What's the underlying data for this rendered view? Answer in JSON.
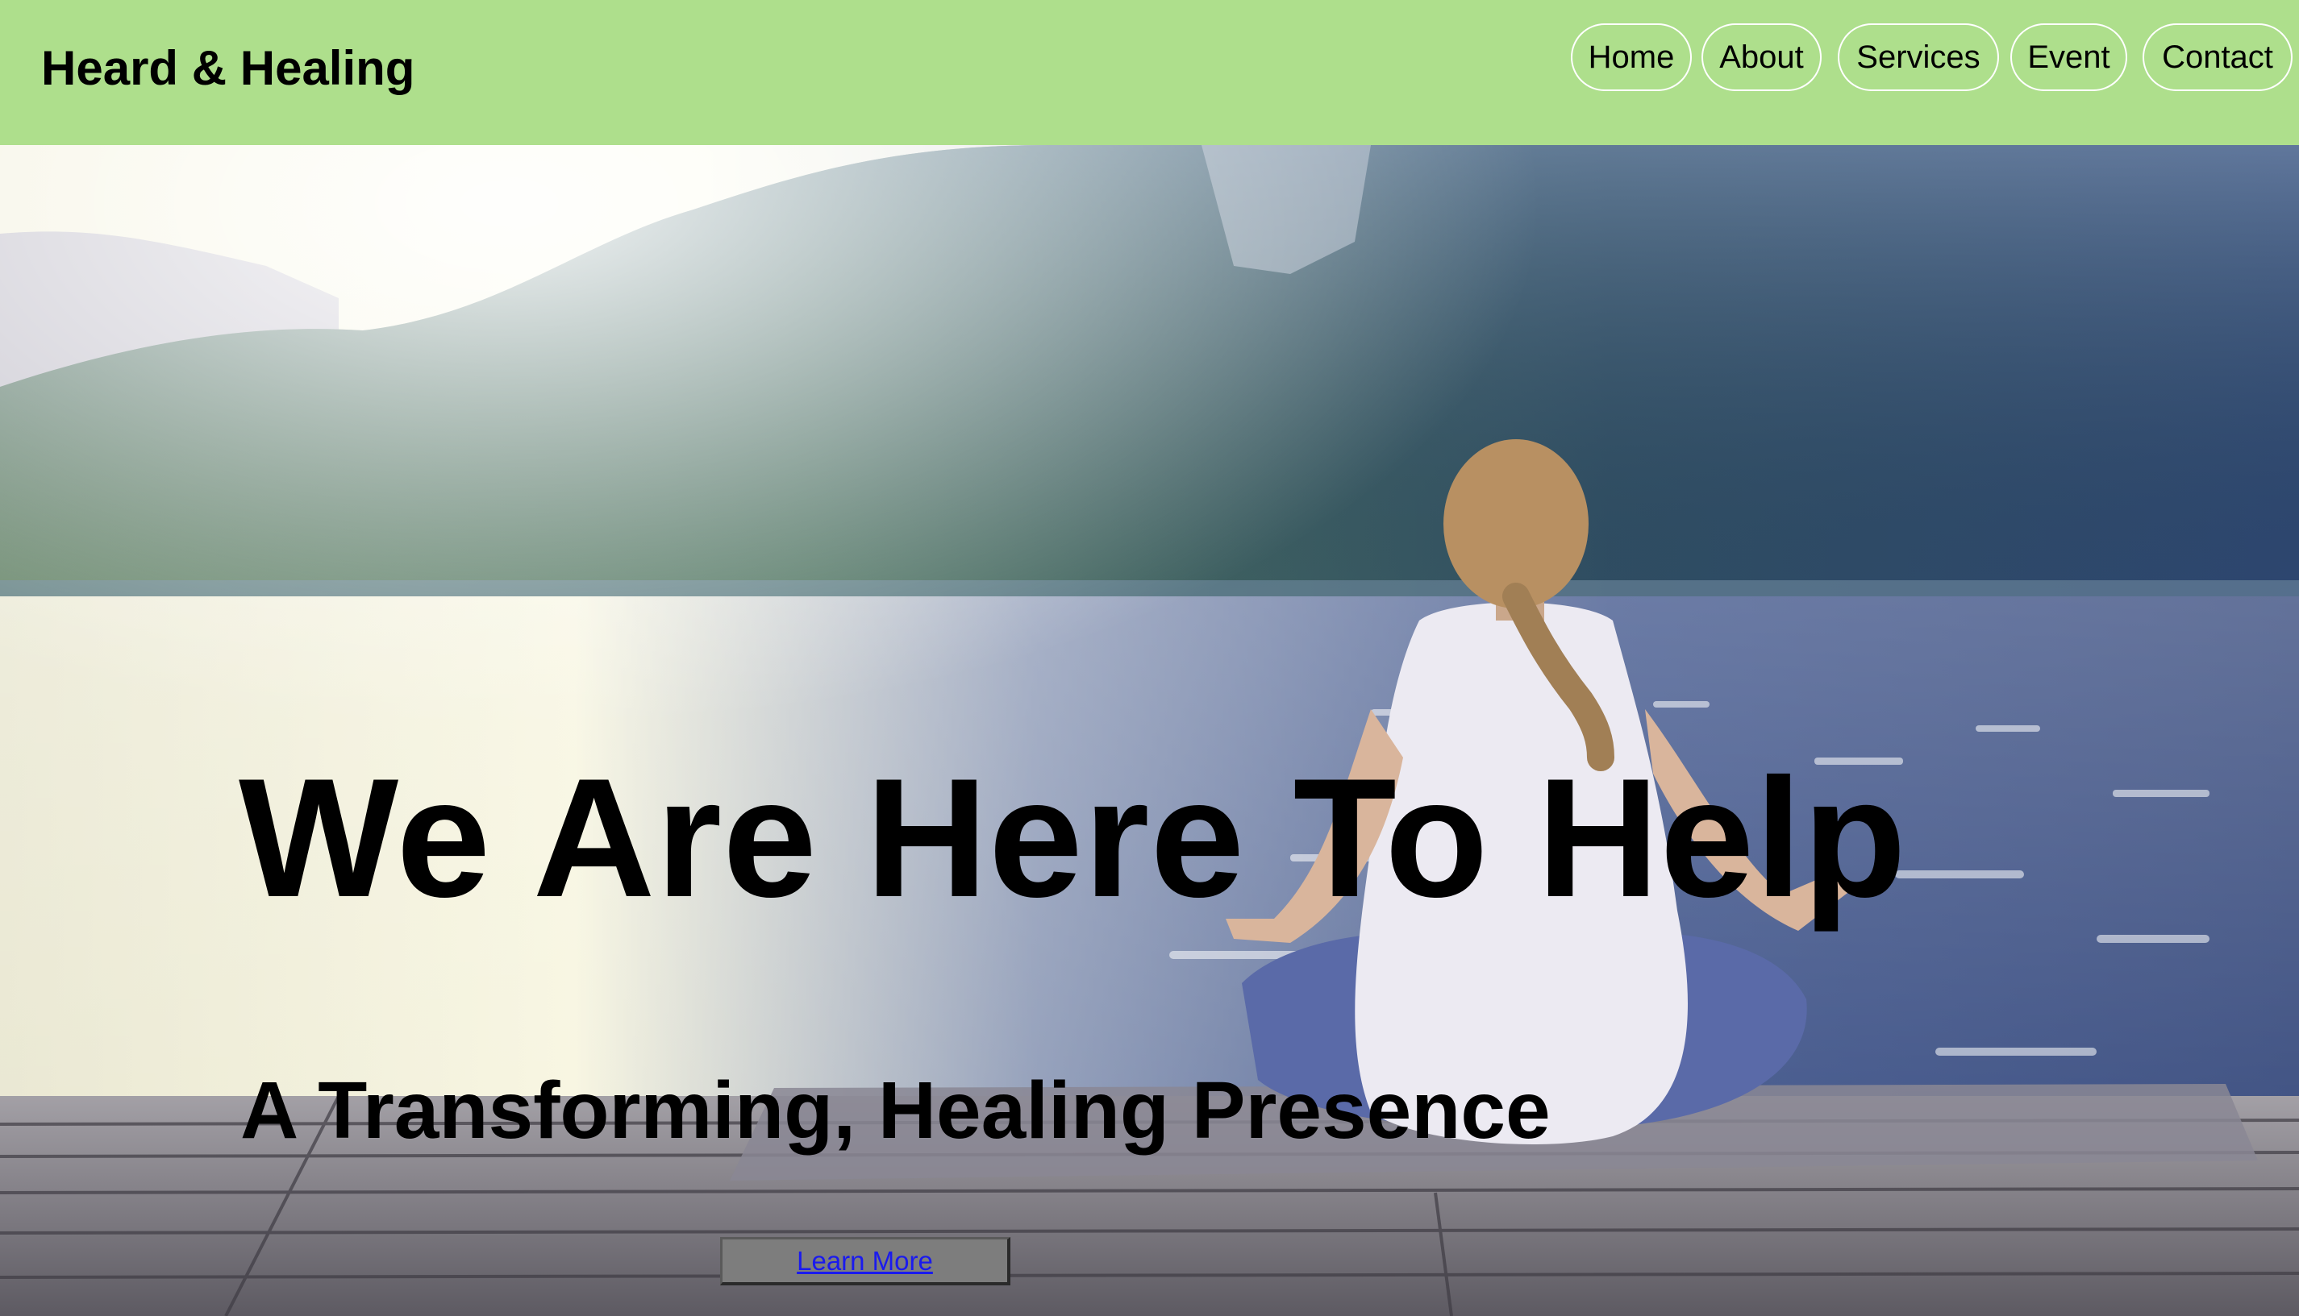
{
  "header": {
    "brand": "Heard & Healing",
    "background_color": "#aedf8c"
  },
  "nav": {
    "items": [
      {
        "label": "Home"
      },
      {
        "label": "About"
      },
      {
        "label": "Services"
      },
      {
        "label": "Event"
      },
      {
        "label": "Contact"
      }
    ]
  },
  "hero": {
    "image_description_icon": "meditation-lake-photo",
    "headline": "We Are Here To Help",
    "subheadline": "A Transforming, Healing Presence",
    "cta_label": "Learn More"
  }
}
